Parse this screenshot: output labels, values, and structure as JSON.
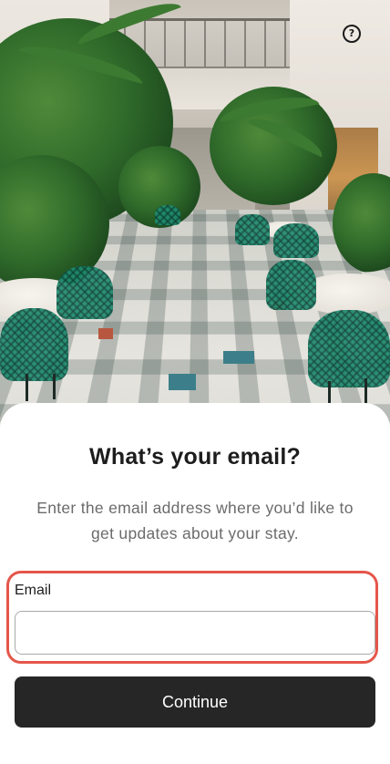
{
  "header": {
    "help_icon": "question-circle-icon",
    "help_glyph": "?"
  },
  "hero": {
    "image": "courtyard-photo"
  },
  "sheet": {
    "title": "What’s your email?",
    "subtitle": "Enter the email address where you’d like to get updates about your stay.",
    "email_label": "Email",
    "email_value": "",
    "email_placeholder": "",
    "continue_label": "Continue"
  },
  "colors": {
    "highlight": "#e5564a",
    "button_bg": "#262626",
    "title": "#1d1d1d",
    "subtitle": "#6b6b6b"
  }
}
